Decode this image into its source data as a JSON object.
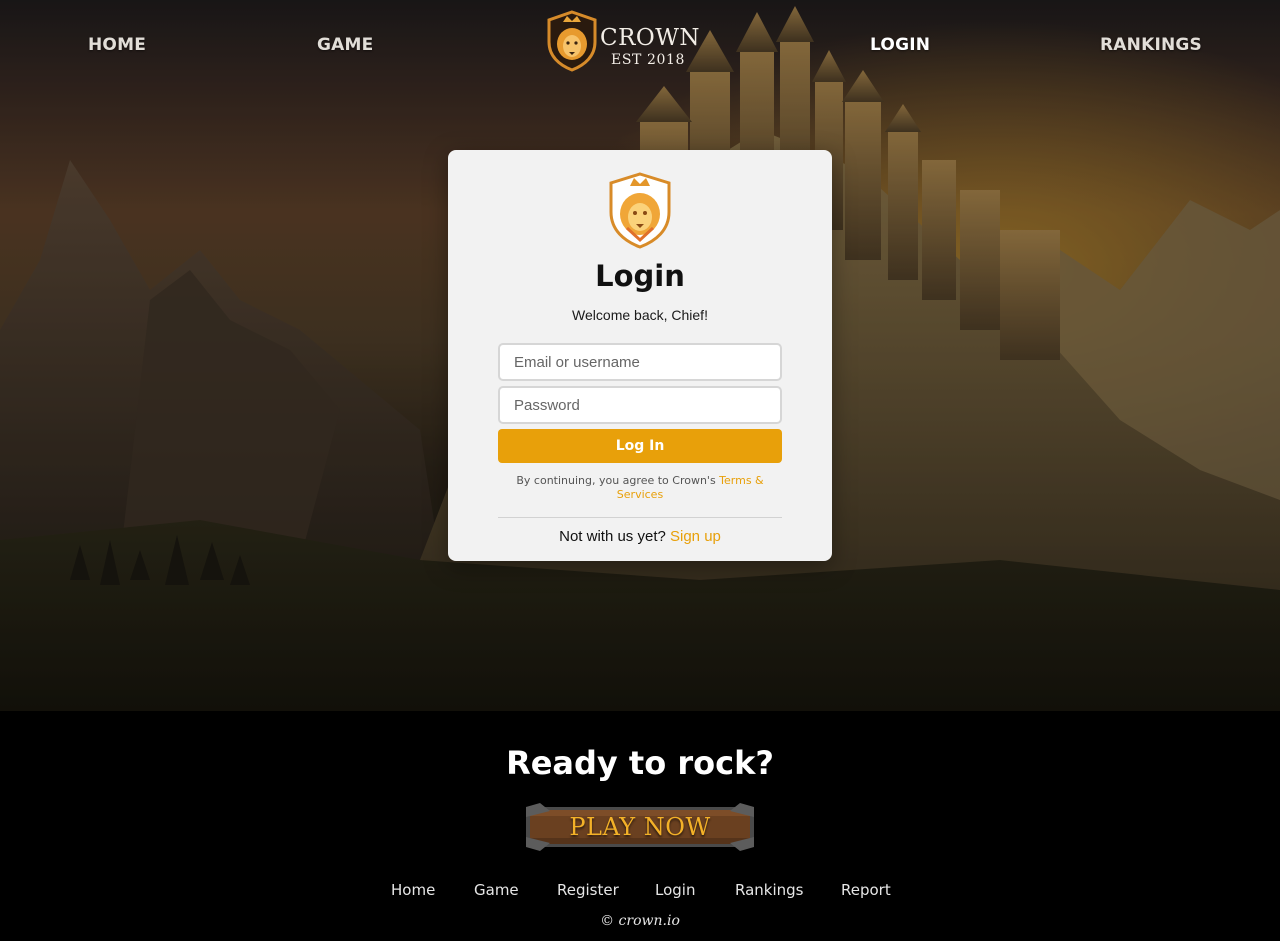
{
  "nav": {
    "home": "HOME",
    "game": "GAME",
    "login": "LOGIN",
    "rankings": "RANKINGS"
  },
  "brand": {
    "name": "CROWN",
    "est": "EST 2018",
    "logo_icon": "lion-crest-shield-icon"
  },
  "login_card": {
    "crest_icon": "lion-crest-shield-icon",
    "title": "Login",
    "subtitle": "Welcome back, Chief!",
    "email_placeholder": "Email or username",
    "email_value": "",
    "password_placeholder": "Password",
    "password_value": "",
    "submit_label": "Log In",
    "terms_prefix": "By continuing, you agree to Crown's ",
    "terms_link": "Terms & Services",
    "signup_prefix": "Not with us yet? ",
    "signup_link": "Sign up"
  },
  "footer": {
    "heading": "Ready to rock?",
    "play_now": "PLAY NOW",
    "links": [
      "Home",
      "Game",
      "Register",
      "Login",
      "Rankings",
      "Report"
    ],
    "copyright": "© crown.io"
  },
  "colors": {
    "accent": "#e8a00a",
    "card_bg": "#f2f2f2",
    "footer_bg": "#000000",
    "play_text": "#f3b128"
  }
}
